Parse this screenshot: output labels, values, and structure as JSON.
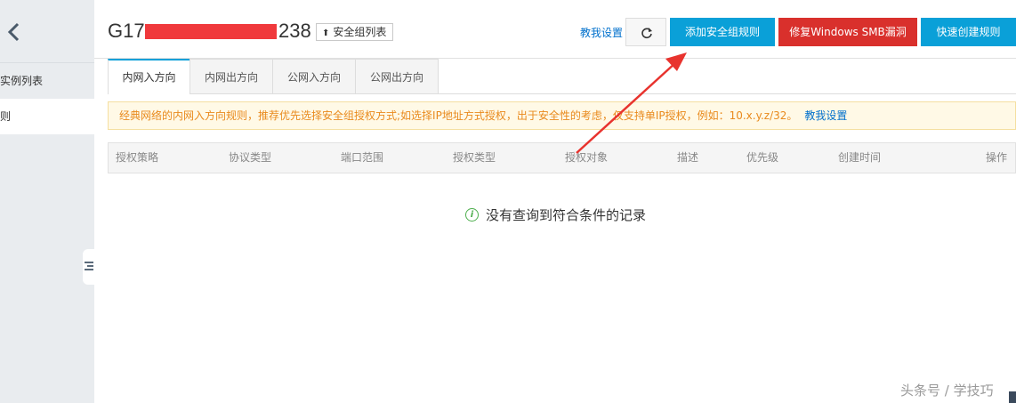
{
  "sidebar": {
    "items": [
      {
        "label": "实例列表",
        "display": "的实例列表"
      },
      {
        "label": "规则"
      }
    ]
  },
  "header": {
    "title_prefix": "G17",
    "title_suffix": "238",
    "sg_list_label": "安全组列表",
    "teach_link": "教我设置",
    "add_rule_label": "添加安全组规则",
    "fix_smb_label": "修复Windows SMB漏洞",
    "quick_create_label": "快速创建规则"
  },
  "tabs": [
    {
      "label": "内网入方向",
      "active": true
    },
    {
      "label": "内网出方向",
      "active": false
    },
    {
      "label": "公网入方向",
      "active": false
    },
    {
      "label": "公网出方向",
      "active": false
    }
  ],
  "notice": {
    "text": "经典网络的内网入方向规则，推荐优先选择安全组授权方式;如选择IP地址方式授权，出于安全性的考虑，仅支持单IP授权，例如：10.x.y.z/32。",
    "link": "教我设置"
  },
  "table": {
    "columns": [
      "授权策略",
      "协议类型",
      "端口范围",
      "授权类型",
      "授权对象",
      "描述",
      "优先级",
      "创建时间",
      "操作"
    ],
    "empty_text": "没有查询到符合条件的记录"
  },
  "watermark": "头条号 / 学技巧",
  "colors": {
    "primary": "#0aa0d8",
    "danger": "#d9302c",
    "link": "#0070cc",
    "notice_text": "#e98a1d",
    "annotation": "#e8332e"
  }
}
